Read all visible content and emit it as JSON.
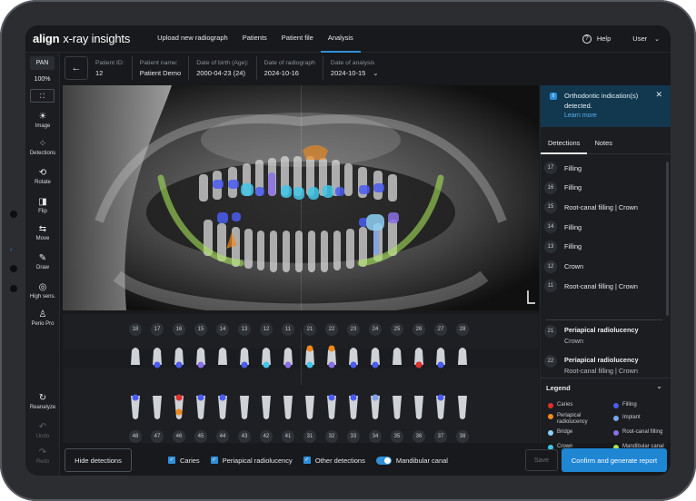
{
  "app": {
    "brand": "align",
    "product": "x-ray insights",
    "nav": [
      "Upload new radiograph",
      "Patients",
      "Patient file",
      "Analysis"
    ],
    "active_nav": "Analysis",
    "help": "Help",
    "user": "User"
  },
  "toolbar": {
    "mode": "PAN",
    "zoom": "100%",
    "tools": [
      "Image",
      "Detections",
      "Rotate",
      "Flip",
      "Move",
      "Draw",
      "High sens.",
      "Perio Pro"
    ],
    "actions": [
      "Reanalyze",
      "Undo",
      "Redo"
    ]
  },
  "patient": {
    "fields": [
      {
        "label": "Patient ID:",
        "value": "12"
      },
      {
        "label": "Patient name:",
        "value": "Patient Demo"
      },
      {
        "label": "Date of birth (Age):",
        "value": "2000-04-23 (24)"
      },
      {
        "label": "Date of radiograph",
        "value": "2024-10-16"
      },
      {
        "label": "Date of analysis",
        "value": "2024-10-15"
      }
    ]
  },
  "teeth": {
    "upper": [
      "18",
      "17",
      "16",
      "15",
      "14",
      "13",
      "12",
      "11",
      "21",
      "22",
      "23",
      "24",
      "25",
      "26",
      "27",
      "28"
    ],
    "lower": [
      "48",
      "47",
      "46",
      "45",
      "44",
      "43",
      "42",
      "41",
      "31",
      "32",
      "33",
      "34",
      "35",
      "36",
      "37",
      "38"
    ]
  },
  "bottom": {
    "hide_detections": "Hide detections",
    "filters": [
      "Caries",
      "Periapical radiolucency",
      "Other detections"
    ],
    "toggle_label": "Mandibular canal",
    "save": "Save",
    "confirm": "Confirm and generate report"
  },
  "panel": {
    "notice_text": "Orthodontic indication(s) detected.",
    "notice_link": "Learn more",
    "tabs": [
      "Detections",
      "Notes"
    ],
    "detections": [
      {
        "tooth": "17",
        "text": "Filling"
      },
      {
        "tooth": "16",
        "text": "Filling"
      },
      {
        "tooth": "15",
        "text": "Root-canal filling | Crown"
      },
      {
        "tooth": "14",
        "text": "Filling"
      },
      {
        "tooth": "13",
        "text": "Filling"
      },
      {
        "tooth": "12",
        "text": "Crown"
      },
      {
        "tooth": "11",
        "text": "Root-canal filling | Crown"
      }
    ],
    "highlighted": [
      {
        "tooth": "21",
        "title": "Periapical radiolucency",
        "sub": "Crown"
      },
      {
        "tooth": "22",
        "title": "Periapical radiolucency",
        "sub": "Root-canal filling | Crown"
      }
    ],
    "legend_title": "Legend",
    "legend": [
      {
        "label": "Caries",
        "color": "#e0302a"
      },
      {
        "label": "Filling",
        "color": "#4a5cf0"
      },
      {
        "label": "Periapical radiolucency",
        "color": "#f08a1c"
      },
      {
        "label": "Implant",
        "color": "#7fa3e8"
      },
      {
        "label": "Bridge",
        "color": "#8fd0f5"
      },
      {
        "label": "Root-canal filling",
        "color": "#8b6fe8"
      },
      {
        "label": "Crown",
        "color": "#42c6e8"
      },
      {
        "label": "Mandibular canal",
        "color": "#a6e25a"
      }
    ]
  }
}
